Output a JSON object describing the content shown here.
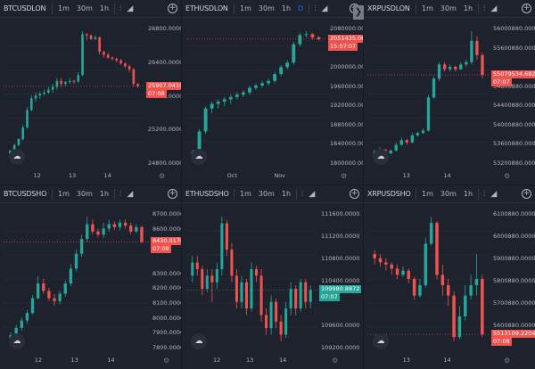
{
  "timeframes": [
    "1m",
    "30m",
    "1h"
  ],
  "panes": [
    {
      "symbol": "BTCUSDLON",
      "extra_tf": "",
      "y_ticks": [
        "26800.0000",
        "26400.0000",
        "25600.0000",
        "25200.0000",
        "24800.0000"
      ],
      "x_ticks": [
        "12",
        "13",
        "14"
      ],
      "price_tag": "25907.0410",
      "time_tag": "07:08",
      "tag_color": "#ef5350",
      "candles": [
        [
          24750,
          24800,
          24700,
          24820
        ],
        [
          24800,
          24900,
          24780,
          24920
        ],
        [
          24900,
          25000,
          24880,
          25020
        ],
        [
          25000,
          25200,
          24980,
          25250
        ],
        [
          25200,
          25500,
          25180,
          25550
        ],
        [
          25500,
          25700,
          25480,
          25750
        ],
        [
          25700,
          25750,
          25650,
          25800
        ],
        [
          25750,
          25780,
          25700,
          25820
        ],
        [
          25780,
          25800,
          25750,
          25850
        ],
        [
          25800,
          25850,
          25780,
          25900
        ],
        [
          25850,
          25900,
          25800,
          25950
        ],
        [
          25900,
          26000,
          25850,
          26050
        ],
        [
          26000,
          25950,
          25900,
          26050
        ],
        [
          25950,
          25980,
          25900,
          26000
        ],
        [
          25980,
          26000,
          25950,
          26050
        ],
        [
          26000,
          25990,
          25950,
          26020
        ],
        [
          25990,
          26100,
          25960,
          26150
        ],
        [
          26100,
          26800,
          26080,
          26850
        ],
        [
          26800,
          26780,
          26700,
          26820
        ],
        [
          26780,
          26720,
          26700,
          26800
        ],
        [
          26720,
          26750,
          26700,
          26780
        ],
        [
          26750,
          26500,
          26450,
          26760
        ],
        [
          26500,
          26450,
          26400,
          26520
        ],
        [
          26450,
          26400,
          26380,
          26480
        ],
        [
          26400,
          26380,
          26350,
          26420
        ],
        [
          26380,
          26350,
          26320,
          26400
        ],
        [
          26350,
          26300,
          26280,
          26380
        ],
        [
          26300,
          26250,
          26220,
          26320
        ],
        [
          26250,
          26200,
          26150,
          26280
        ],
        [
          26200,
          25950,
          25900,
          26220
        ],
        [
          25950,
          25907,
          25880,
          25960
        ]
      ]
    },
    {
      "symbol": "ETHUSDLON",
      "extra_tf": "D",
      "y_ticks": [
        "2080000.0000",
        "2051435.0665",
        "2000000.0000",
        "1960000.0000",
        "1920000.0000",
        "1880000.0000",
        "1840000.0000",
        "1800000.0000"
      ],
      "x_ticks": [
        "Oct",
        "Nov"
      ],
      "price_tag": "2051435.0665",
      "time_tag": "15:07:07",
      "tag_color": "#ef5350",
      "candles": [
        [
          1800000,
          1805000,
          1795000,
          1810000
        ],
        [
          1805000,
          1850000,
          1800000,
          1855000
        ],
        [
          1850000,
          1900000,
          1845000,
          1905000
        ],
        [
          1900000,
          1910000,
          1890000,
          1915000
        ],
        [
          1910000,
          1915000,
          1900000,
          1920000
        ],
        [
          1915000,
          1920000,
          1905000,
          1925000
        ],
        [
          1920000,
          1925000,
          1910000,
          1930000
        ],
        [
          1925000,
          1930000,
          1920000,
          1935000
        ],
        [
          1930000,
          1935000,
          1925000,
          1940000
        ],
        [
          1935000,
          1945000,
          1930000,
          1950000
        ],
        [
          1945000,
          1950000,
          1940000,
          1955000
        ],
        [
          1950000,
          1955000,
          1945000,
          1960000
        ],
        [
          1955000,
          1960000,
          1950000,
          1965000
        ],
        [
          1960000,
          1975000,
          1955000,
          1980000
        ],
        [
          1975000,
          1990000,
          1970000,
          1995000
        ],
        [
          1990000,
          2000000,
          1985000,
          2005000
        ],
        [
          2000000,
          2040000,
          1995000,
          2045000
        ],
        [
          2040000,
          2060000,
          2035000,
          2065000
        ],
        [
          2060000,
          2062000,
          2055000,
          2068000
        ],
        [
          2062000,
          2055000,
          2050000,
          2065000
        ],
        [
          2055000,
          2051435,
          2048000,
          2058000
        ]
      ]
    },
    {
      "symbol": "XRPUSDLON",
      "extra_tf": "",
      "y_ticks": [
        "56000880.0000",
        "55600880.0000",
        "55079534.6822",
        "54800880.0000",
        "54400880.0000",
        "54000880.0000",
        "53600880.0000",
        "53200880.0000"
      ],
      "x_ticks": [
        "13",
        "14"
      ],
      "price_tag": "55079534.6822",
      "time_tag": "07:07",
      "tag_color": "#ef5350",
      "candles": [
        [
          53400000,
          53450000,
          53350000,
          53500000
        ],
        [
          53450000,
          53500000,
          53400000,
          53550000
        ],
        [
          53500000,
          53420000,
          53380000,
          53520000
        ],
        [
          53420000,
          53480000,
          53400000,
          53500000
        ],
        [
          53480000,
          53600000,
          53460000,
          53650000
        ],
        [
          53600000,
          53700000,
          53580000,
          53750000
        ],
        [
          53700000,
          53650000,
          53600000,
          53720000
        ],
        [
          53650000,
          53800000,
          53630000,
          53850000
        ],
        [
          53800000,
          53850000,
          53780000,
          53880000
        ],
        [
          53850000,
          53900000,
          53830000,
          53950000
        ],
        [
          53900000,
          54600000,
          53880000,
          54650000
        ],
        [
          54600000,
          55000000,
          54580000,
          55050000
        ],
        [
          55000000,
          55300000,
          54950000,
          55350000
        ],
        [
          55300000,
          55200000,
          55150000,
          55350000
        ],
        [
          55200000,
          55250000,
          55150000,
          55300000
        ],
        [
          55250000,
          55200000,
          55150000,
          55280000
        ],
        [
          55200000,
          55300000,
          55180000,
          55350000
        ],
        [
          55300000,
          55350000,
          55250000,
          55400000
        ],
        [
          55350000,
          55800000,
          55300000,
          56000000
        ],
        [
          55800000,
          55500000,
          55400000,
          55900000
        ],
        [
          55500000,
          55079534,
          55000000,
          55550000
        ]
      ]
    },
    {
      "symbol": "BTCUSDSHO",
      "extra_tf": "",
      "y_ticks": [
        "8700.0000",
        "8600.0000",
        "8500.0000",
        "8430.0170",
        "8300.0000",
        "8200.0000",
        "8100.0000",
        "8000.0000",
        "7900.0000",
        "7800.0000"
      ],
      "x_ticks": [
        "12",
        "13",
        "14"
      ],
      "price_tag": "8430.0170",
      "time_tag": "07:08",
      "tag_color": "#ef5350",
      "candles": [
        [
          7780,
          7800,
          7760,
          7820
        ],
        [
          7800,
          7850,
          7790,
          7870
        ],
        [
          7850,
          7900,
          7830,
          7920
        ],
        [
          7900,
          7950,
          7880,
          7970
        ],
        [
          7950,
          8050,
          7940,
          8070
        ],
        [
          8050,
          8150,
          8040,
          8200
        ],
        [
          8150,
          8100,
          8080,
          8180
        ],
        [
          8100,
          8050,
          8030,
          8120
        ],
        [
          8050,
          8030,
          8000,
          8080
        ],
        [
          8030,
          8080,
          8010,
          8100
        ],
        [
          8080,
          8150,
          8060,
          8170
        ],
        [
          8150,
          8250,
          8130,
          8280
        ],
        [
          8250,
          8350,
          8230,
          8380
        ],
        [
          8350,
          8450,
          8330,
          8480
        ],
        [
          8450,
          8550,
          8430,
          8600
        ],
        [
          8550,
          8500,
          8480,
          8580
        ],
        [
          8500,
          8480,
          8460,
          8520
        ],
        [
          8480,
          8520,
          8460,
          8560
        ],
        [
          8520,
          8550,
          8500,
          8580
        ],
        [
          8550,
          8530,
          8510,
          8570
        ],
        [
          8530,
          8560,
          8510,
          8580
        ],
        [
          8560,
          8540,
          8520,
          8580
        ],
        [
          8540,
          8500,
          8480,
          8560
        ],
        [
          8500,
          8530,
          8490,
          8550
        ],
        [
          8530,
          8430,
          8420,
          8540
        ]
      ]
    },
    {
      "symbol": "ETHUSDSHO",
      "extra_tf": "",
      "y_ticks": [
        "111600.0000",
        "111200.0000",
        "110800.0000",
        "110400.0000",
        "109980.8872",
        "109600.0000",
        "109200.0000"
      ],
      "x_ticks": [
        "12",
        "13",
        "14"
      ],
      "price_tag": "109980.8872",
      "time_tag": "07:07",
      "tag_color": "#26a69a",
      "candles": [
        [
          110200,
          110400,
          110100,
          110500
        ],
        [
          110400,
          110300,
          110200,
          110500
        ],
        [
          110300,
          110000,
          109900,
          110350
        ],
        [
          110000,
          110200,
          109950,
          110300
        ],
        [
          110200,
          110100,
          109800,
          110300
        ],
        [
          110100,
          110300,
          110000,
          110400
        ],
        [
          110300,
          111000,
          110200,
          111100
        ],
        [
          111000,
          110600,
          110500,
          111050
        ],
        [
          110600,
          110200,
          110100,
          110700
        ],
        [
          110200,
          109800,
          109700,
          110300
        ],
        [
          109800,
          110100,
          109700,
          110200
        ],
        [
          110100,
          109700,
          109600,
          110150
        ],
        [
          109700,
          110300,
          109650,
          110400
        ],
        [
          110300,
          110200,
          110100,
          110350
        ],
        [
          110200,
          109600,
          109500,
          110300
        ],
        [
          109600,
          109400,
          109300,
          109700
        ],
        [
          109400,
          109800,
          109300,
          109900
        ],
        [
          109800,
          109500,
          109400,
          109850
        ],
        [
          109500,
          109300,
          109200,
          109600
        ],
        [
          109300,
          109700,
          109250,
          109800
        ],
        [
          109700,
          110000,
          109600,
          110100
        ],
        [
          110000,
          109700,
          109600,
          110050
        ],
        [
          109700,
          110100,
          109650,
          110150
        ],
        [
          110100,
          109800,
          109700,
          110150
        ],
        [
          109800,
          109980,
          109700,
          110050
        ]
      ]
    },
    {
      "symbol": "XRPUSDSHO",
      "extra_tf": "",
      "y_ticks": [
        "6100880.0000",
        "6000880.0000",
        "5900880.0000",
        "5800880.0000",
        "5700880.0000",
        "5600880.0000",
        "5513109.2204"
      ],
      "x_ticks": [
        "13",
        "14"
      ],
      "price_tag": "5513109.2204",
      "time_tag": "07:08",
      "tag_color": "#ef5350",
      "candles": [
        [
          5900000,
          5880000,
          5850000,
          5920000
        ],
        [
          5880000,
          5860000,
          5840000,
          5900000
        ],
        [
          5860000,
          5850000,
          5820000,
          5880000
        ],
        [
          5850000,
          5830000,
          5800000,
          5860000
        ],
        [
          5830000,
          5800000,
          5780000,
          5850000
        ],
        [
          5800000,
          5820000,
          5790000,
          5840000
        ],
        [
          5820000,
          5780000,
          5760000,
          5830000
        ],
        [
          5780000,
          5700000,
          5680000,
          5790000
        ],
        [
          5700000,
          5750000,
          5690000,
          5780000
        ],
        [
          5750000,
          5950000,
          5740000,
          5980000
        ],
        [
          5950000,
          6050000,
          5940000,
          6080000
        ],
        [
          6050000,
          5800000,
          5780000,
          6060000
        ],
        [
          5800000,
          5750000,
          5700000,
          5850000
        ],
        [
          5750000,
          5700000,
          5650000,
          5780000
        ],
        [
          5700000,
          5500000,
          5480000,
          5720000
        ],
        [
          5500000,
          5600000,
          5490000,
          5650000
        ],
        [
          5600000,
          5700000,
          5580000,
          5750000
        ],
        [
          5700000,
          5750000,
          5680000,
          5800000
        ],
        [
          5750000,
          5780000,
          5700000,
          5900000
        ],
        [
          5780000,
          5513109,
          5500000,
          5800000
        ]
      ]
    }
  ]
}
